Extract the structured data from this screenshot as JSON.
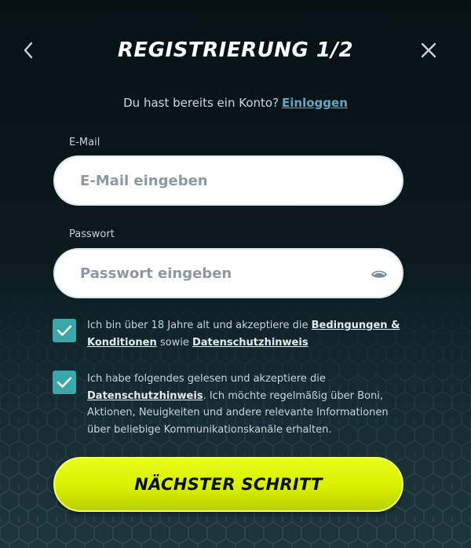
{
  "header": {
    "title": "REGISTRIERUNG 1/2",
    "back_icon": "chevron-left-icon",
    "close_icon": "close-icon"
  },
  "login_prompt": {
    "text": "Du hast bereits ein Konto?",
    "link_label": "Einloggen"
  },
  "form": {
    "email": {
      "label": "E-Mail",
      "placeholder": "E-Mail eingeben",
      "value": ""
    },
    "password": {
      "label": "Passwort",
      "placeholder": "Passwort eingeben",
      "value": "",
      "toggle_icon": "eye-icon"
    }
  },
  "consents": [
    {
      "checked": true,
      "text_before": "Ich bin über 18 Jahre alt und akzeptiere die",
      "link1": "Bedingungen & Konditionen",
      "text_between": "sowie",
      "link2": "Datenschutzhinweis"
    },
    {
      "checked": true,
      "text_before": "Ich habe folgendes gelesen und akzeptiere die",
      "link1": "Datenschutzhinweis",
      "text_after": ". Ich möchte regelmäßig über Boni, Aktionen, Neuigkeiten und andere relevante Informationen über beliebige Kommunikationskanäle erhalten."
    }
  ],
  "next_button": {
    "label": "NÄCHSTER SCHRITT"
  },
  "colors": {
    "background": "#0a191d",
    "accent_button": "#d8f000",
    "checkbox": "#3aa7a9",
    "link": "#5fa9c6"
  }
}
